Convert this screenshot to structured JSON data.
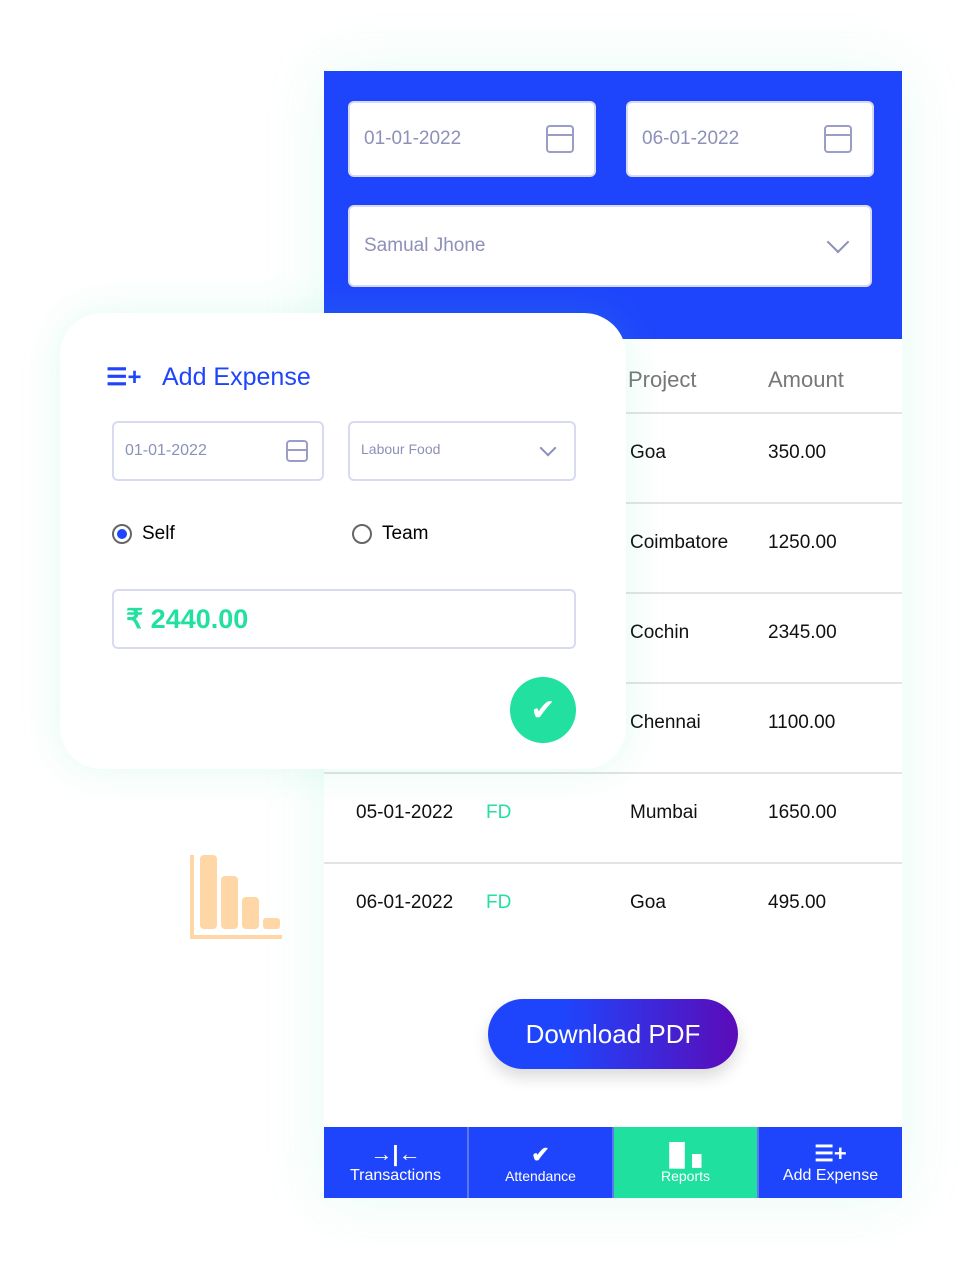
{
  "filters": {
    "from_date": "01-01-2022",
    "to_date": "06-01-2022",
    "employee": "Samual Jhone"
  },
  "table": {
    "headers": {
      "project": "Project",
      "amount": "Amount"
    },
    "rows": [
      {
        "project": "Goa",
        "amount": "350.00"
      },
      {
        "project": "Coimbatore",
        "amount": "1250.00"
      },
      {
        "project": "Cochin",
        "amount": "2345.00"
      },
      {
        "project": "Chennai",
        "amount": "1100.00"
      },
      {
        "date": "05-01-2022",
        "type": "FD",
        "project": "Mumbai",
        "amount": "1650.00"
      },
      {
        "date": "06-01-2022",
        "type": "FD",
        "project": "Goa",
        "amount": "495.00"
      }
    ]
  },
  "download_label": "Download PDF",
  "nav": [
    {
      "label": "Transactions",
      "icon": "transactions-icon"
    },
    {
      "label": "Attendance",
      "icon": "check-icon"
    },
    {
      "label": "Reports",
      "icon": "bar-chart-icon",
      "active": true
    },
    {
      "label": "Add Expense",
      "icon": "add-list-icon"
    }
  ],
  "add_expense": {
    "title": "Add Expense",
    "date": "01-01-2022",
    "category": "Labour Food",
    "options": [
      "Self",
      "Team"
    ],
    "selected": "Self",
    "amount": "₹ 2440.00"
  },
  "colors": {
    "primary": "#1f45fc",
    "accent": "#22e0a0",
    "decor": "#ffd6a5"
  }
}
